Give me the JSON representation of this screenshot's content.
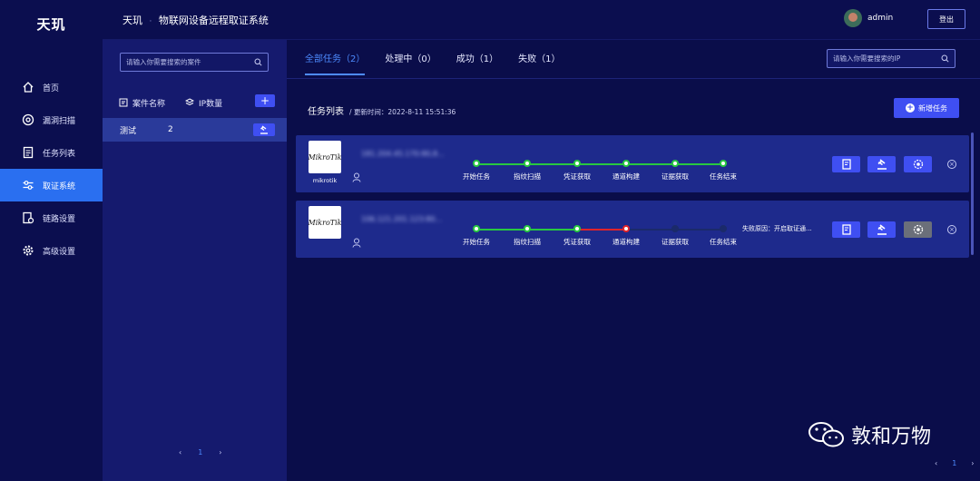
{
  "app": {
    "brand": "天玑",
    "breadcrumb_root": "天玑",
    "breadcrumb_sep": "·",
    "title": "物联网设备远程取证系统"
  },
  "user": {
    "name": "admin",
    "logout_label": "登出"
  },
  "nav": {
    "items": [
      {
        "label": "首页",
        "icon": "home-icon"
      },
      {
        "label": "漏洞扫描",
        "icon": "scan-icon"
      },
      {
        "label": "任务列表",
        "icon": "task-list-icon"
      },
      {
        "label": "取证系统",
        "icon": "forensics-icon",
        "active": true
      },
      {
        "label": "链路设置",
        "icon": "link-settings-icon"
      },
      {
        "label": "高级设置",
        "icon": "gear-icon"
      }
    ]
  },
  "cases": {
    "search_placeholder": "请输入你需要搜索的案件",
    "col_name": "案件名称",
    "col_ip": "IP数量",
    "add_label": "+",
    "rows": [
      {
        "name": "测试",
        "ip_count": "2"
      }
    ],
    "pager": {
      "prev": "‹",
      "page": "1",
      "next": "›"
    }
  },
  "tabs": [
    {
      "label": "全部任务（2）",
      "active": true
    },
    {
      "label": "处理中（0）"
    },
    {
      "label": "成功（1）"
    },
    {
      "label": "失败（1）"
    }
  ],
  "ip_search_placeholder": "请输入你需要搜索的IP",
  "task_list": {
    "title": "任务列表",
    "updated": "/ 更新时间：2022-8-11 15:51:36",
    "new_task_label": "新增任务"
  },
  "step_labels": [
    "开始任务",
    "指纹扫描",
    "凭证获取",
    "通道构建",
    "证据获取",
    "任务结束"
  ],
  "tasks": [
    {
      "brand": "MikroTik",
      "brand_label": "mikrotik",
      "ip": "181.204.45.170:80,8...",
      "status": [
        "done",
        "done",
        "done",
        "done",
        "done",
        "done"
      ],
      "reason": ""
    },
    {
      "brand": "MikroTik",
      "brand_label": "",
      "ip": "106.121.201.123:80...",
      "status": [
        "done",
        "done",
        "done",
        "fail",
        "pending",
        "pending"
      ],
      "reason": "失败原因：开启取证通..."
    }
  ],
  "main_pager": {
    "prev": "‹",
    "page": "1",
    "next": "›"
  },
  "watermark": "敦和万物",
  "colors": {
    "accent": "#3f4ff2",
    "success": "#28c840",
    "fail": "#e0242a",
    "active_nav": "#2a6ff0"
  }
}
